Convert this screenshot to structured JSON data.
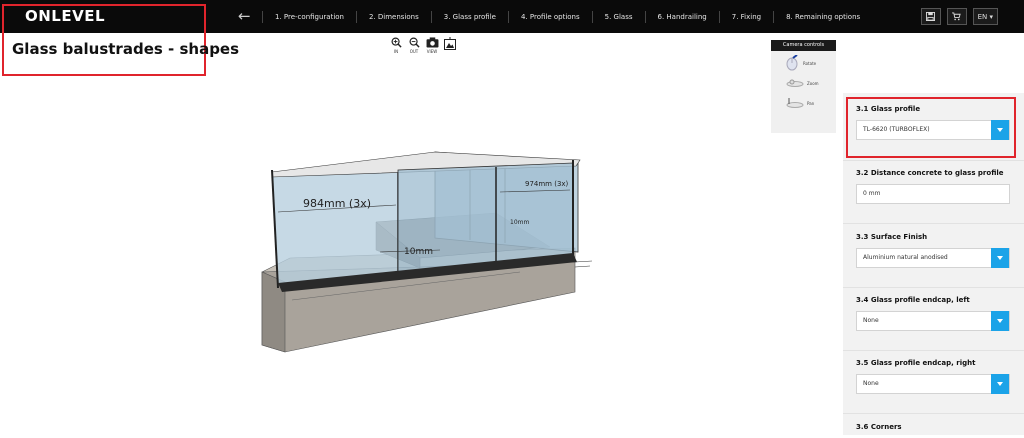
{
  "header": {
    "logo": "ONLEVEL",
    "back_icon": "back-arrow-icon",
    "steps": [
      "1. Pre-configuration",
      "2. Dimensions",
      "3. Glass profile",
      "4. Profile options",
      "5. Glass",
      "6. Handrailing",
      "7. Fixing",
      "8. Remaining options"
    ],
    "language": "EN ▾"
  },
  "page": {
    "title": "Glass balustrades - shapes"
  },
  "view_tools": {
    "zoom_in": "IN",
    "zoom_out": "OUT",
    "view": "VIEW"
  },
  "camera": {
    "title": "Camera controls",
    "rotate": "Rotate",
    "zoom": "Zoom",
    "pan": "Pan"
  },
  "model": {
    "dim_left": "984mm (3x)",
    "dim_right": "974mm (3x)",
    "dim_gap_front": "10mm",
    "dim_gap_right": "10mm"
  },
  "sidebar": {
    "glass_profile_label": "3.1 Glass profile",
    "glass_profile_value": "TL-6620 (TURBOFLEX)",
    "distance_label": "3.2 Distance concrete to glass profile",
    "distance_value": "0 mm",
    "finish_label": "3.3 Surface Finish",
    "finish_value": "Aluminium natural anodised",
    "endcap_left_label": "3.4 Glass profile endcap, left",
    "endcap_left_value": "None",
    "endcap_right_label": "3.5 Glass profile endcap, right",
    "endcap_right_value": "None",
    "corners_label": "3.6 Corners"
  },
  "colors": {
    "accent": "#1ba3e8",
    "highlight": "#e0242c",
    "topbar": "#0a0a0a"
  }
}
